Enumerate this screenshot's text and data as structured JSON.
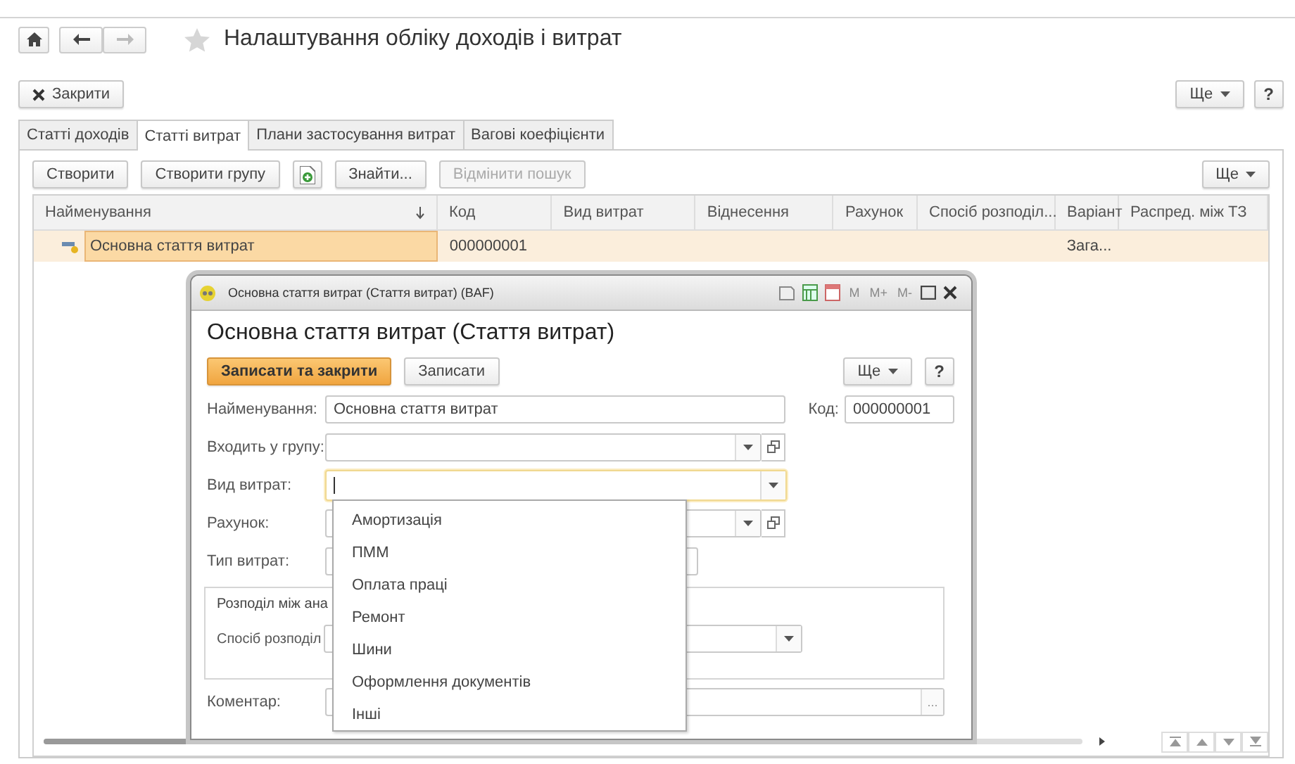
{
  "page": {
    "title": "Налаштування обліку доходів і витрат",
    "close_button": "Закрити",
    "more_button": "Ще",
    "help_button": "?"
  },
  "tabs": [
    {
      "label": "Статті доходів",
      "selected": false
    },
    {
      "label": "Статті витрат",
      "selected": true
    },
    {
      "label": "Плани застосування витрат",
      "selected": false
    },
    {
      "label": "Вагові коефіцієнти",
      "selected": false
    }
  ],
  "toolbar": {
    "buttons": [
      {
        "kind": "text",
        "label": "Створити",
        "disabled": false
      },
      {
        "kind": "text",
        "label": "Створити групу",
        "disabled": false
      },
      {
        "kind": "icon",
        "disabled": false
      },
      {
        "kind": "text",
        "label": "Знайти...",
        "disabled": false
      },
      {
        "kind": "text",
        "label": "Відмінити пошук",
        "disabled": true
      }
    ],
    "more_button": "Ще"
  },
  "table": {
    "columns": [
      {
        "label": "Найменування",
        "sorted": true
      },
      {
        "label": "Код",
        "sorted": false
      },
      {
        "label": "Вид витрат",
        "sorted": false
      },
      {
        "label": "Віднесення",
        "sorted": false
      },
      {
        "label": "Рахунок",
        "sorted": false
      },
      {
        "label": "Спосіб розподіл...",
        "sorted": false
      },
      {
        "label": "Варіант",
        "sorted": false
      },
      {
        "label": "Распред. між ТЗ",
        "sorted": false
      }
    ],
    "rows": [
      {
        "selected": true,
        "cells": [
          {
            "text": "Основна стаття витрат",
            "current": true
          },
          {
            "text": "000000001",
            "current": false
          },
          {
            "text": "",
            "current": false
          },
          {
            "text": "",
            "current": false
          },
          {
            "text": "",
            "current": false
          },
          {
            "text": "",
            "current": false
          },
          {
            "text": "Зага...",
            "current": false
          },
          {
            "text": "",
            "current": false
          }
        ]
      }
    ]
  },
  "dialog": {
    "window_title": "Основна стаття витрат (Стаття витрат) (BAF)",
    "memory_buttons": [
      "M",
      "M+",
      "M-"
    ],
    "heading": "Основна стаття витрат (Стаття витрат)",
    "buttons": [
      {
        "label": "Записати та закрити",
        "kind": "primary"
      },
      {
        "label": "Записати",
        "kind": "plain"
      }
    ],
    "more_button": "Ще",
    "help_button": "?",
    "fields": [
      {
        "label": "Найменування:",
        "kind": "text",
        "value": "Основна стаття витрат",
        "focused": false,
        "code_label": "Код:",
        "code_value": "000000001"
      },
      {
        "label": "Входить у групу:",
        "kind": "select",
        "open_button": true,
        "focused": false
      },
      {
        "label": "Вид витрат:",
        "kind": "select",
        "open_button": false,
        "focused": true
      },
      {
        "label": "Рахунок:",
        "kind": "select",
        "open_button": true,
        "focused": false
      },
      {
        "label": "Тип витрат:",
        "kind": "short",
        "focused": false
      }
    ],
    "group": {
      "title": "Розподіл між ана",
      "field_label": "Спосіб розподіл"
    },
    "comment_label": "Коментар:",
    "comment_button": "..."
  },
  "dropdown": {
    "items": [
      "Амортизація",
      "ПММ",
      "Оплата праці",
      "Ремонт",
      "Шини",
      "Оформлення документів",
      "Інші"
    ]
  }
}
